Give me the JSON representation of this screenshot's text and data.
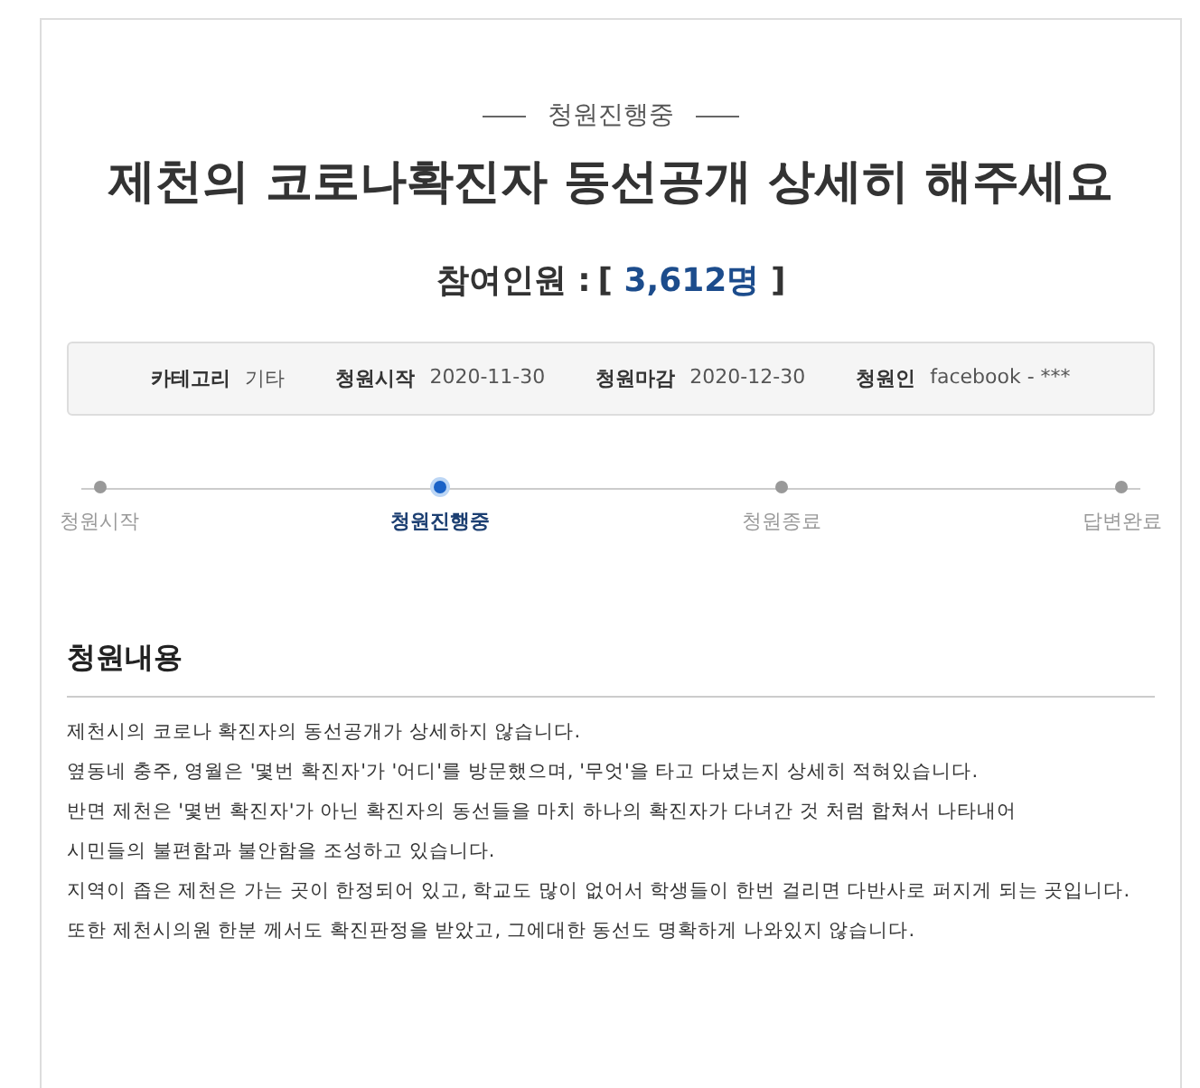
{
  "status_label": "청원진행중",
  "title": "제천의 코로나확진자 동선공개 상세히 해주세요",
  "participants": {
    "label": "참여인원 :",
    "bracket_open": "[",
    "count": "3,612명",
    "bracket_close": "]"
  },
  "info": [
    {
      "label": "카테고리",
      "value": "기타"
    },
    {
      "label": "청원시작",
      "value": "2020-11-30"
    },
    {
      "label": "청원마감",
      "value": "2020-12-30"
    },
    {
      "label": "청원인",
      "value": "facebook - ***"
    }
  ],
  "steps": [
    {
      "label": "청원시작",
      "selected": false
    },
    {
      "label": "청원진행중",
      "selected": true
    },
    {
      "label": "청원종료",
      "selected": false
    },
    {
      "label": "답변완료",
      "selected": false
    }
  ],
  "content": {
    "heading": "청원내용",
    "lines": [
      "제천시의 코로나 확진자의 동선공개가 상세하지 않습니다.",
      "옆동네 충주, 영월은 '몇번 확진자'가 '어디'를 방문했으며, '무엇'을 타고 다녔는지 상세히 적혀있습니다.",
      "반면 제천은 '몇번 확진자'가 아닌 확진자의 동선들을 마치 하나의 확진자가 다녀간 것 처럼 합쳐서 나타내어",
      "시민들의 불편함과 불안함을 조성하고 있습니다.",
      "지역이 좁은 제천은 가는 곳이 한정되어 있고, 학교도 많이 없어서 학생들이 한번 걸리면 다반사로 퍼지게 되는 곳입니다.",
      "또한 제천시의원 한분 께서도 확진판정을 받았고, 그에대한 동선도 명확하게 나와있지 않습니다."
    ]
  }
}
